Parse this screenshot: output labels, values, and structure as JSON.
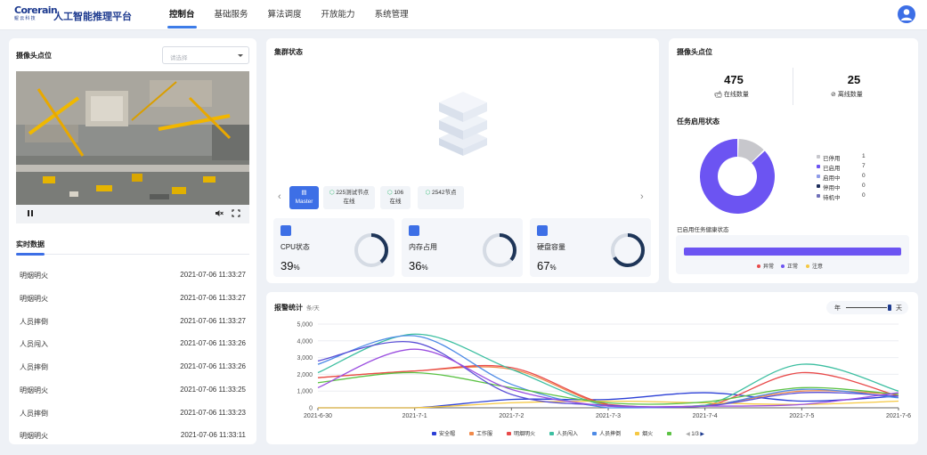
{
  "header": {
    "logo_text": "Corerain",
    "logo_sub": "鲲云科技",
    "app_title": "人工智能推理平台",
    "nav": [
      "控制台",
      "基础服务",
      "算法调度",
      "开放能力",
      "系统管理"
    ]
  },
  "camera_panel": {
    "title": "摄像头点位",
    "select_placeholder": "请选择",
    "play_icon": "pause-icon",
    "mute_icon": "mute-icon",
    "fullscreen_icon": "fullscreen-icon"
  },
  "realtime": {
    "title": "实时数据",
    "rows": [
      {
        "event": "明烟明火",
        "time": "2021-07-06 11:33:27"
      },
      {
        "event": "明烟明火",
        "time": "2021-07-06 11:33:27"
      },
      {
        "event": "人员摔倒",
        "time": "2021-07-06 11:33:27"
      },
      {
        "event": "人员闯入",
        "time": "2021-07-06 11:33:26"
      },
      {
        "event": "人员摔倒",
        "time": "2021-07-06 11:33:26"
      },
      {
        "event": "明烟明火",
        "time": "2021-07-06 11:33:25"
      },
      {
        "event": "人员摔倒",
        "time": "2021-07-06 11:33:23"
      },
      {
        "event": "明烟明火",
        "time": "2021-07-06 11:33:11"
      }
    ]
  },
  "cluster": {
    "title": "集群状态",
    "nodes": [
      {
        "line1": "Master",
        "line2": ""
      },
      {
        "line1": "225测试节点",
        "line2": "在线"
      },
      {
        "line1": "106",
        "line2": "在线"
      },
      {
        "line1": "2542节点",
        "line2": ""
      }
    ],
    "metrics": [
      {
        "label": "CPU状态",
        "value": "39",
        "unit": "%",
        "percent": 39
      },
      {
        "label": "内存占用",
        "value": "36",
        "unit": "%",
        "percent": 36
      },
      {
        "label": "硬盘容量",
        "value": "67",
        "unit": "%",
        "percent": 67
      }
    ],
    "colors": {
      "ring": "#1e3558",
      "ring_bg": "#d5dbe4",
      "accent": "#3d6fe6"
    }
  },
  "camera_stats": {
    "title": "摄像头点位",
    "online_count": "475",
    "online_label": "在线数量",
    "offline_count": "25",
    "offline_label": "离线数量",
    "task_title": "任务启用状态",
    "task_status": [
      {
        "label": "已停用",
        "count": "1",
        "color": "#c7c7cc"
      },
      {
        "label": "已启用",
        "count": "7",
        "color": "#6c54f2"
      },
      {
        "label": "启用中",
        "count": "0",
        "color": "#8f9be8"
      },
      {
        "label": "停用中",
        "count": "0",
        "color": "#1e2d5a"
      },
      {
        "label": "待机中",
        "count": "0",
        "color": "#7070b8"
      }
    ],
    "health_title": "已启用任务健康状态",
    "health_legend": [
      {
        "label": "异常",
        "color": "#e84a4a"
      },
      {
        "label": "正常",
        "color": "#6c54f2"
      },
      {
        "label": "注意",
        "color": "#f5c842"
      }
    ]
  },
  "alarm": {
    "title": "报警统计",
    "unit": "条/天",
    "range_low": "年",
    "range_high": "天",
    "pager": "1/3"
  },
  "chart_data": {
    "type": "line",
    "title": "报警统计",
    "x": [
      "2021-6-30",
      "2021-7-1",
      "2021-7-2",
      "2021-7-3",
      "2021-7-4",
      "2021-7-5",
      "2021-7-6"
    ],
    "yticks": [
      0,
      1000,
      2000,
      3000,
      4000,
      5000
    ],
    "ylim": [
      0,
      5000
    ],
    "grid": true,
    "legend_position": "bottom",
    "series": [
      {
        "name": "安全帽",
        "color": "#2b3fd6",
        "values": [
          0,
          0,
          500,
          500,
          900,
          400,
          700
        ]
      },
      {
        "name": "工作服",
        "color": "#f08a4b",
        "values": [
          1800,
          2200,
          2300,
          150,
          150,
          1000,
          800
        ]
      },
      {
        "name": "明烟明火",
        "color": "#e84a4a",
        "values": [
          1800,
          2200,
          2400,
          200,
          100,
          2100,
          700
        ]
      },
      {
        "name": "人员闯入",
        "color": "#3dbfa1",
        "values": [
          2100,
          4400,
          2300,
          100,
          150,
          2600,
          1000
        ]
      },
      {
        "name": "人员摔倒",
        "color": "#4d8ae6",
        "values": [
          2600,
          4300,
          1400,
          0,
          100,
          1100,
          600
        ]
      },
      {
        "name": "烟火",
        "color": "#f5c842",
        "values": [
          0,
          0,
          300,
          400,
          300,
          200,
          400
        ]
      },
      {
        "name": "",
        "color": "#5cc244",
        "values": [
          1500,
          2100,
          1200,
          300,
          350,
          1200,
          800
        ]
      },
      {
        "name": "",
        "color": "#5a4fd6",
        "values": [
          2800,
          3900,
          800,
          150,
          100,
          900,
          700
        ]
      },
      {
        "name": "",
        "color": "#9b4fe0",
        "values": [
          1200,
          3500,
          1100,
          100,
          100,
          200,
          900
        ]
      }
    ]
  }
}
